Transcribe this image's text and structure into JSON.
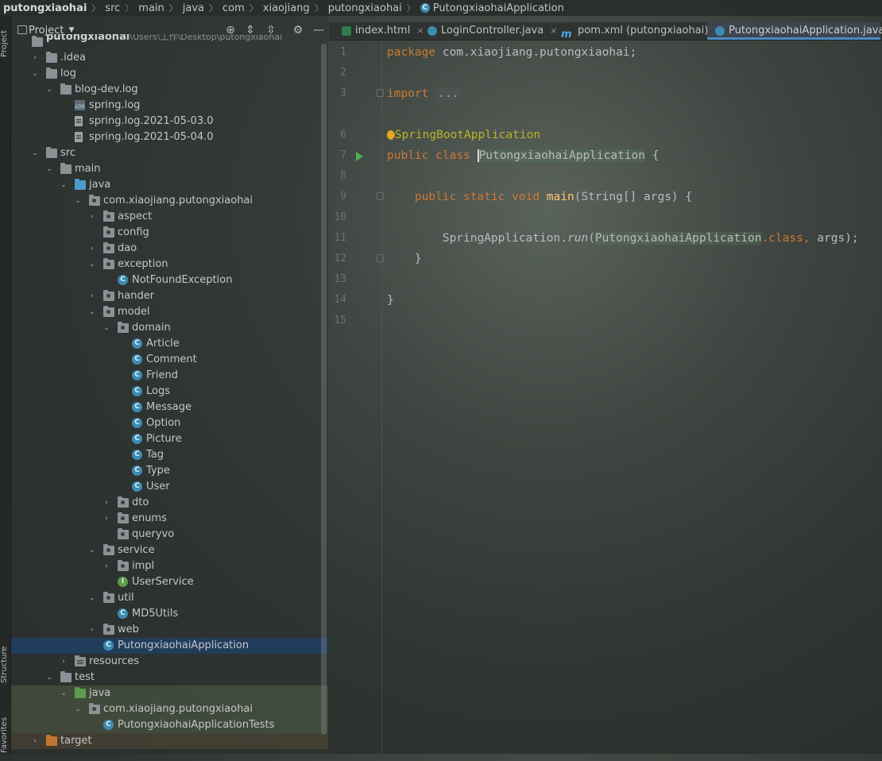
{
  "breadcrumb": [
    "putongxiaohai",
    "src",
    "main",
    "java",
    "com",
    "xiaojiang",
    "putongxiaohai",
    "PutongxiaohaiApplication"
  ],
  "tool_strip": {
    "project": "Project",
    "structure": "Structure",
    "favorites": "Favorites"
  },
  "project_panel": {
    "title": "Project",
    "root": {
      "name": "putongxiaohai",
      "path": "C:\\Users\\工作\\Desktop\\putongxiaohai"
    },
    "tree": [
      {
        "label": ".idea",
        "icon": "folder-icon",
        "arrow": "›"
      },
      {
        "label": "log",
        "icon": "folder-icon",
        "arrow": "⌄"
      },
      {
        "label": "blog-dev.log",
        "icon": "folder-icon",
        "arrow": "⌄"
      },
      {
        "label": "spring.log",
        "icon": "log-file-icon"
      },
      {
        "label": "spring.log.2021-05-03.0",
        "icon": "text-file-icon"
      },
      {
        "label": "spring.log.2021-05-04.0",
        "icon": "text-file-icon"
      },
      {
        "label": "src",
        "icon": "folder-icon",
        "arrow": "⌄"
      },
      {
        "label": "main",
        "icon": "folder-icon",
        "arrow": "⌄"
      },
      {
        "label": "java",
        "icon": "source-folder-icon",
        "arrow": "⌄"
      },
      {
        "label": "com.xiaojiang.putongxiaohai",
        "icon": "package-icon",
        "arrow": "⌄"
      },
      {
        "label": "aspect",
        "icon": "package-icon",
        "arrow": "›"
      },
      {
        "label": "config",
        "icon": "package-icon"
      },
      {
        "label": "dao",
        "icon": "package-icon",
        "arrow": "›"
      },
      {
        "label": "exception",
        "icon": "package-icon",
        "arrow": "⌄"
      },
      {
        "label": "NotFoundException",
        "icon": "class-icon"
      },
      {
        "label": "hander",
        "icon": "package-icon",
        "arrow": "›"
      },
      {
        "label": "model",
        "icon": "package-icon",
        "arrow": "⌄"
      },
      {
        "label": "domain",
        "icon": "package-icon",
        "arrow": "⌄"
      },
      {
        "label": "Article",
        "icon": "class-icon"
      },
      {
        "label": "Comment",
        "icon": "class-icon"
      },
      {
        "label": "Friend",
        "icon": "class-icon"
      },
      {
        "label": "Logs",
        "icon": "class-icon"
      },
      {
        "label": "Message",
        "icon": "class-icon"
      },
      {
        "label": "Option",
        "icon": "class-icon"
      },
      {
        "label": "Picture",
        "icon": "class-icon"
      },
      {
        "label": "Tag",
        "icon": "class-icon"
      },
      {
        "label": "Type",
        "icon": "class-icon"
      },
      {
        "label": "User",
        "icon": "class-icon"
      },
      {
        "label": "dto",
        "icon": "package-icon",
        "arrow": "›"
      },
      {
        "label": "enums",
        "icon": "package-icon",
        "arrow": "›"
      },
      {
        "label": "queryvo",
        "icon": "package-icon"
      },
      {
        "label": "service",
        "icon": "package-icon",
        "arrow": "⌄"
      },
      {
        "label": "impl",
        "icon": "package-icon",
        "arrow": "›"
      },
      {
        "label": "UserService",
        "icon": "interface-icon"
      },
      {
        "label": "util",
        "icon": "package-icon",
        "arrow": "⌄"
      },
      {
        "label": "MD5Utils",
        "icon": "class-icon"
      },
      {
        "label": "web",
        "icon": "package-icon",
        "arrow": "›"
      },
      {
        "label": "PutongxiaohaiApplication",
        "icon": "spring-class-icon"
      },
      {
        "label": "resources",
        "icon": "resources-folder-icon",
        "arrow": "›"
      },
      {
        "label": "test",
        "icon": "folder-icon",
        "arrow": "⌄"
      },
      {
        "label": "java",
        "icon": "test-folder-icon",
        "arrow": "⌄"
      },
      {
        "label": "com.xiaojiang.putongxiaohai",
        "icon": "package-icon",
        "arrow": "⌄"
      },
      {
        "label": "PutongxiaohaiApplicationTests",
        "icon": "spring-class-icon"
      },
      {
        "label": "target",
        "icon": "excluded-folder-icon",
        "arrow": "›"
      }
    ]
  },
  "editor_tabs": [
    {
      "label": "index.html",
      "icon": "html-file-icon"
    },
    {
      "label": "LoginController.java",
      "icon": "class-icon"
    },
    {
      "label": "pom.xml (putongxiaohai)",
      "icon": "maven-icon"
    },
    {
      "label": "PutongxiaohaiApplication.java",
      "icon": "spring-class-icon",
      "active": true
    }
  ],
  "code": {
    "line_numbers": [
      "1",
      "2",
      "3",
      "6",
      "7",
      "8",
      "9",
      "10",
      "11",
      "12",
      "13",
      "14",
      "15"
    ],
    "l1_kw": "package",
    "l1_rest": " com.xiaojiang.putongxiaohai;",
    "l3_kw": "import",
    "l3_folded": "...",
    "l6_at": "@",
    "l6_ann": "SpringBootApplication",
    "l7_kw": "public class",
    "l7_name": "PutongxiaohaiApplication",
    "l7_brace": " {",
    "l9_kw": "public static void",
    "l9_fn": "main",
    "l9_rest": "(String[] args) {",
    "l11_cls": "SpringApplication.",
    "l11_fn": "run",
    "l11_arg": "PutongxiaohaiApplication",
    "l11_kwclass": ".class,",
    "l11_rest": " args);",
    "l12": "}",
    "l14": "}"
  }
}
